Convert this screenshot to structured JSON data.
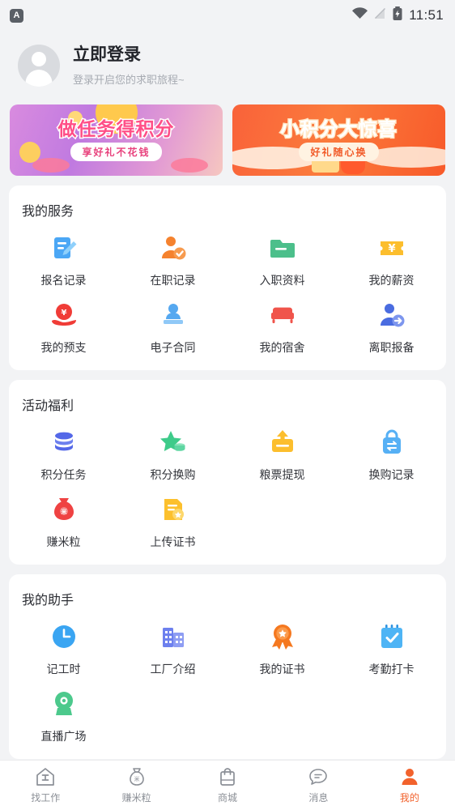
{
  "status_bar": {
    "app_badge": "A",
    "time": "11:51",
    "icons": [
      "wifi-icon",
      "signal-off-icon",
      "battery-charging-icon"
    ]
  },
  "profile": {
    "name": "立即登录",
    "subtitle": "登录开启您的求职旅程~",
    "avatar": "default-avatar"
  },
  "banners": [
    {
      "title": "做任务得积分",
      "pill": "享好礼不花钱",
      "color": "#c07ae0"
    },
    {
      "title": "小积分大惊喜",
      "pill": "好礼随心换",
      "color": "#f9623a"
    }
  ],
  "sections": [
    {
      "title": "我的服务",
      "items": [
        {
          "label": "报名记录",
          "icon": "document-pen-icon",
          "color": "#4ba7f5"
        },
        {
          "label": "在职记录",
          "icon": "person-check-icon",
          "color": "#f5822e"
        },
        {
          "label": "入职资料",
          "icon": "folder-icon",
          "color": "#4cbf8b"
        },
        {
          "label": "我的薪资",
          "icon": "salary-ticket-icon",
          "color": "#fcbe2d"
        },
        {
          "label": "我的预支",
          "icon": "hand-coin-icon",
          "color": "#f03c37"
        },
        {
          "label": "电子合同",
          "icon": "stamp-icon",
          "color": "#55a8f0"
        },
        {
          "label": "我的宿舍",
          "icon": "bed-icon",
          "color": "#f0544b"
        },
        {
          "label": "离职报备",
          "icon": "person-exit-icon",
          "color": "#4a6ce0"
        }
      ]
    },
    {
      "title": "活动福利",
      "items": [
        {
          "label": "积分任务",
          "icon": "coin-stack-icon",
          "color": "#5468e8"
        },
        {
          "label": "积分换购",
          "icon": "star-coin-icon",
          "color": "#3ecb8a"
        },
        {
          "label": "粮票提现",
          "icon": "withdraw-card-icon",
          "color": "#fcbe2d"
        },
        {
          "label": "换购记录",
          "icon": "exchange-bag-icon",
          "color": "#56b0f5"
        },
        {
          "label": "赚米粒",
          "icon": "money-bag-icon",
          "color": "#ef4242"
        },
        {
          "label": "上传证书",
          "icon": "certificate-upload-icon",
          "color": "#fcc02d"
        }
      ]
    },
    {
      "title": "我的助手",
      "items": [
        {
          "label": "记工时",
          "icon": "clock-icon",
          "color": "#3aa5f2"
        },
        {
          "label": "工厂介绍",
          "icon": "building-icon",
          "color": "#6d80ee"
        },
        {
          "label": "我的证书",
          "icon": "medal-icon",
          "color": "#f5781f"
        },
        {
          "label": "考勤打卡",
          "icon": "calendar-check-icon",
          "color": "#4eb4f5"
        },
        {
          "label": "直播广场",
          "icon": "camera-icon",
          "color": "#4cc98c"
        }
      ]
    }
  ],
  "tabbar": {
    "active_color": "#f2622c",
    "items": [
      {
        "label": "找工作",
        "icon": "home-job-icon",
        "active": false
      },
      {
        "label": "赚米粒",
        "icon": "money-bag-icon",
        "active": false
      },
      {
        "label": "商城",
        "icon": "shop-bag-icon",
        "active": false
      },
      {
        "label": "消息",
        "icon": "message-icon",
        "active": false
      },
      {
        "label": "我的",
        "icon": "user-icon",
        "active": true
      }
    ]
  }
}
